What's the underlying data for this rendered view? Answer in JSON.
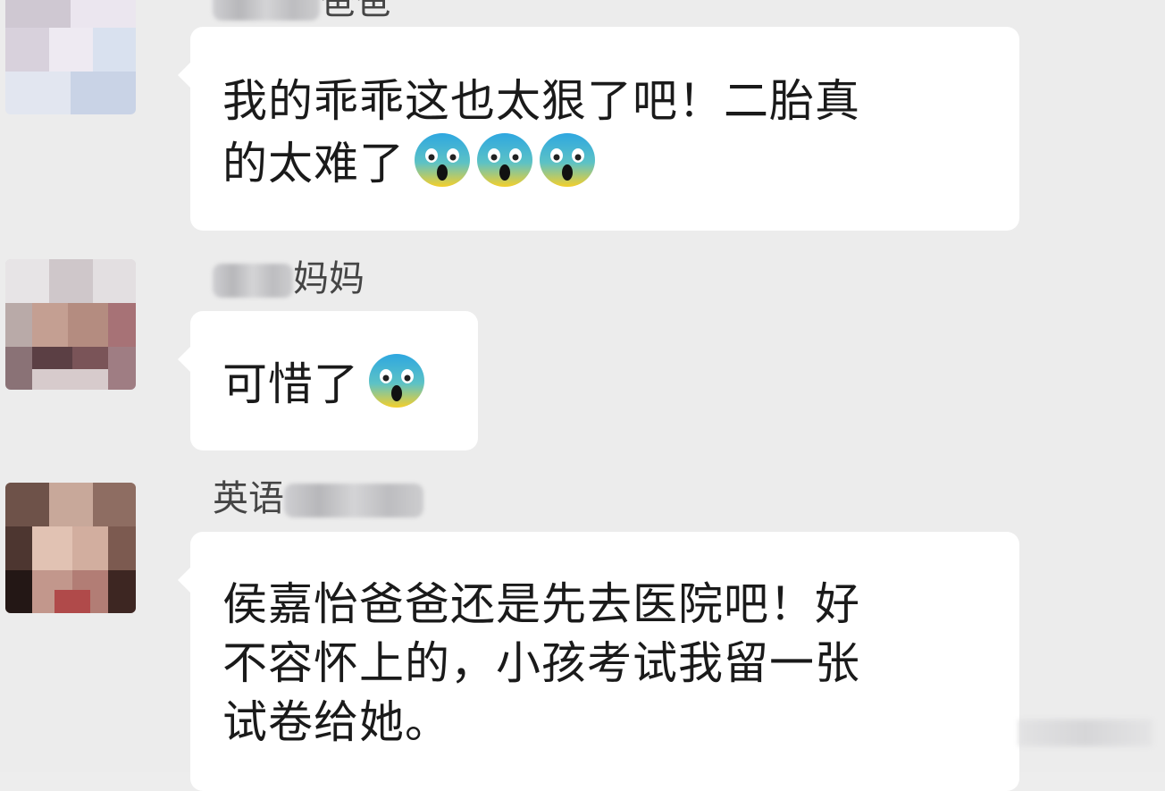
{
  "messages": [
    {
      "sender_suffix": "爸爸",
      "lines": [
        "我的乖乖这也太狠了吧！二胎真",
        "的太难了"
      ],
      "emoji": [
        "fearful-face",
        "fearful-face",
        "fearful-face"
      ]
    },
    {
      "sender_suffix": "妈妈",
      "lines": [
        "可惜了"
      ],
      "emoji": [
        "fearful-face"
      ]
    },
    {
      "sender_prefix": "英语",
      "lines": [
        "侯嘉怡爸爸还是先去医院吧！好",
        "不容怀上的，小孩考试我留一张",
        "试卷给她。"
      ],
      "emoji": []
    }
  ],
  "colors": {
    "background": "#ececec",
    "bubble": "#ffffff",
    "text": "#1a1a1a",
    "sender_name": "#454545"
  }
}
